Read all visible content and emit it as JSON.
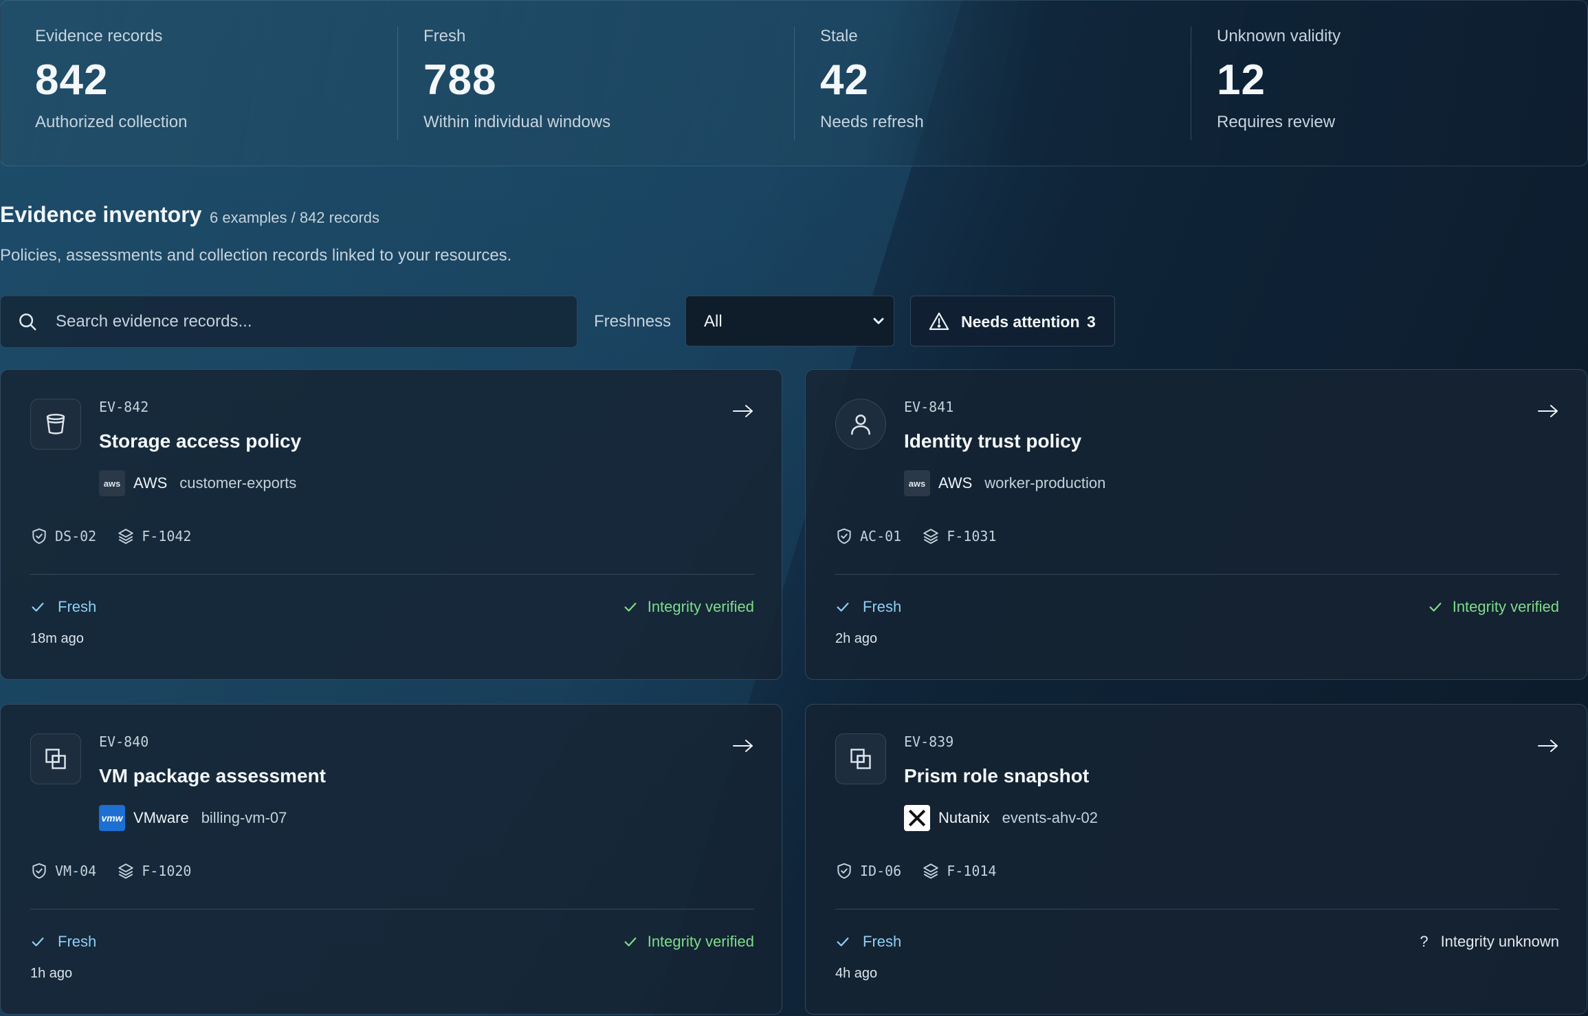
{
  "colors": {
    "fresh": "#8ed0f5",
    "verified": "#7edd8a",
    "background": "#0c1a2a",
    "card": "#16233200"
  },
  "stats": [
    {
      "label": "Evidence records",
      "value": "842",
      "sub": "Authorized collection"
    },
    {
      "label": "Fresh",
      "value": "788",
      "sub": "Within individual windows"
    },
    {
      "label": "Stale",
      "value": "42",
      "sub": "Needs refresh"
    },
    {
      "label": "Unknown validity",
      "value": "12",
      "sub": "Requires review"
    }
  ],
  "section": {
    "title": "Evidence inventory",
    "count": "6 examples / 842 records",
    "description": "Policies, assessments and collection records linked to your resources."
  },
  "toolbar": {
    "search_placeholder": "Search evidence records...",
    "freshness_label": "Freshness",
    "freshness_value": "All",
    "attention_label": "Needs attention",
    "attention_count": "3"
  },
  "cards": [
    {
      "id": "EV-842",
      "title": "Storage access policy",
      "icon": "bucket-icon",
      "vendor": "AWS",
      "vendor_logo": "aws",
      "resource": "customer-exports",
      "control": "DS-02",
      "finding": "F-1042",
      "freshness": "Fresh",
      "integrity": "Integrity verified",
      "ago": "18m ago"
    },
    {
      "id": "EV-841",
      "title": "Identity trust policy",
      "icon": "user-icon",
      "vendor": "AWS",
      "vendor_logo": "aws",
      "resource": "worker-production",
      "control": "AC-01",
      "finding": "F-1031",
      "freshness": "Fresh",
      "integrity": "Integrity verified",
      "ago": "2h ago"
    },
    {
      "id": "EV-840",
      "title": "VM package assessment",
      "icon": "vm-stack-icon",
      "vendor": "VMware",
      "vendor_logo": "vmw",
      "resource": "billing-vm-07",
      "control": "VM-04",
      "finding": "F-1020",
      "freshness": "Fresh",
      "integrity": "Integrity verified",
      "ago": "1h ago"
    },
    {
      "id": "EV-839",
      "title": "Prism role snapshot",
      "icon": "vm-stack-icon",
      "vendor": "Nutanix",
      "vendor_logo": "nutanix",
      "resource": "events-ahv-02",
      "control": "ID-06",
      "finding": "F-1014",
      "freshness": "Fresh",
      "integrity": "Integrity unknown",
      "integrity_mark": "?",
      "ago": "4h ago"
    }
  ]
}
